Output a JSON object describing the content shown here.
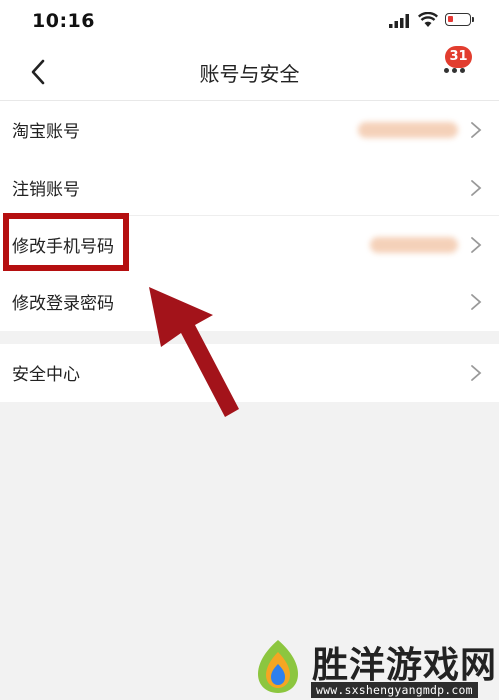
{
  "status_bar": {
    "time": "10:16"
  },
  "nav": {
    "title": "账号与安全",
    "badge_count": "31"
  },
  "rows": [
    {
      "label": "淘宝账号"
    },
    {
      "label": "注销账号"
    },
    {
      "label": "修改手机号码"
    },
    {
      "label": "修改登录密码"
    },
    {
      "label": "安全中心"
    }
  ],
  "colors": {
    "accent_red": "#e23d2f",
    "highlight": "#b50f10",
    "background": "#f2f2f2"
  },
  "watermark": {
    "title": "胜洋游戏网",
    "url": "www.sxshengyangmdp.com"
  }
}
